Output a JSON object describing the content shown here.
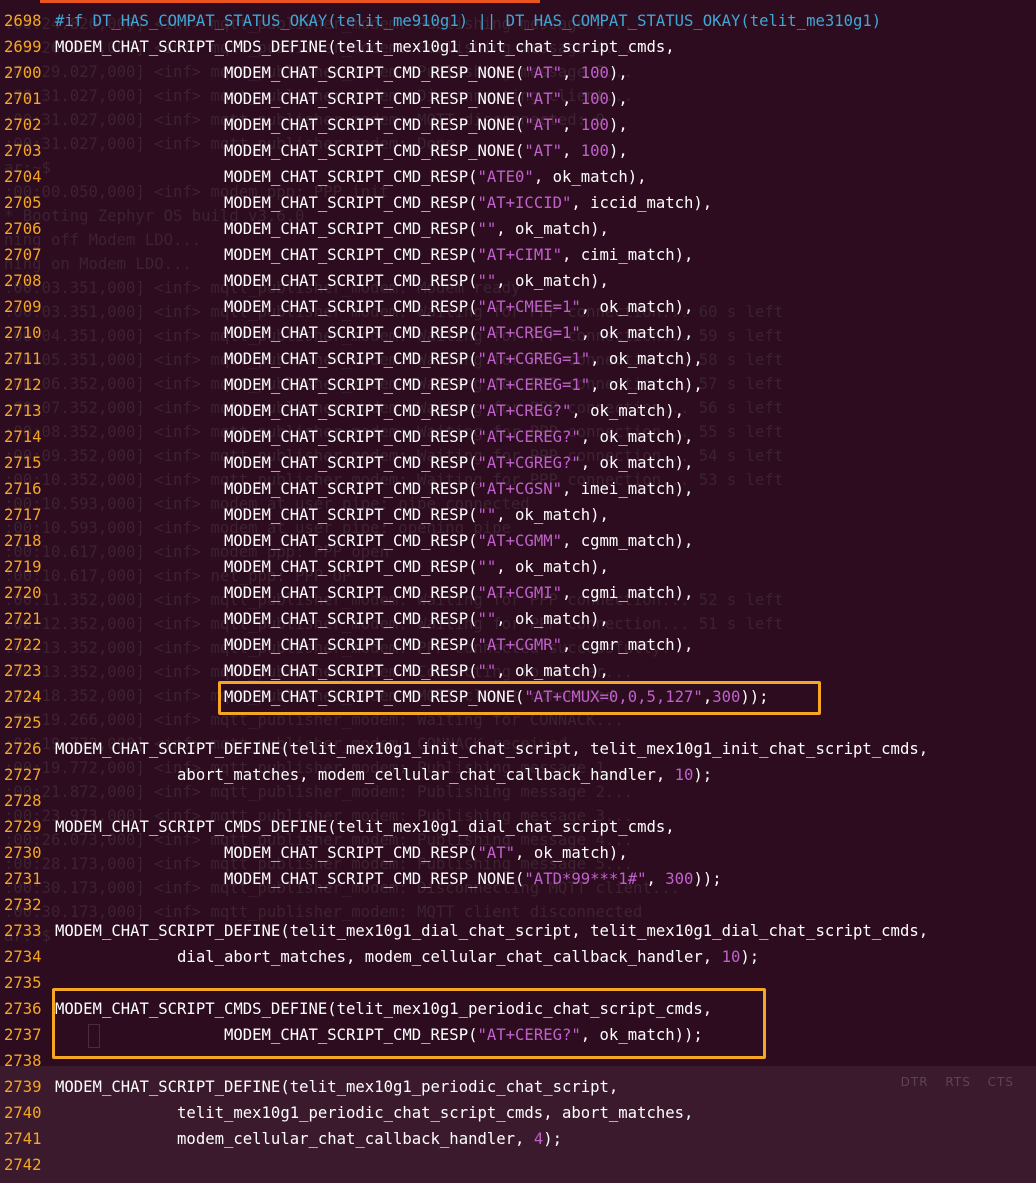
{
  "editor": {
    "background_color": "#2c0c1e",
    "line_number_color": "#f5a623",
    "highlight_color": "#f5a623",
    "string_color": "#c061cb",
    "keyword_color": "#3fa7d6"
  },
  "serial_indicators": [
    "DTR",
    "RTS",
    "CTS"
  ],
  "ghost_terminal": [
    ":00:24.826,000] <inf> mqtt_publisher_modem: Publishing message 3...",
    ":00:26.927,000] <inf> mqtt_publisher_modem: Publishing message 4...",
    ":00:29.027,000] <inf> mqtt_publisher_modem: Publishing message 5...",
    ":00:31.027,000] <inf> mqtt_publisher_modem: Disconnecting client...",
    ":00:31.027,000] <inf> mqtt_publisher_modem: MQTT disconnected: 0",
    ":00:31.027,000] <inf> mqtt_publisher_modem: Done",
    "ar:~$",
    ":00:00.050,000] <inf> modem_ppp: PPP init",
    "* Booting Zephyr OS build v3.6.0",
    "ning off Modem LDO...",
    "ning on Modem LDO...",
    ":00:03.351,000] <inf> mqtt_publisher_modem: Modem ready",
    ":00:03.351,000] <inf> mqtt_publisher_modem: Waiting for PPP connection... 60 s left",
    ":00:04.351,000] <inf> mqtt_publisher_modem: Waiting for PPP connection... 59 s left",
    ":00:05.351,000] <inf> mqtt_publisher_modem: Waiting for PPP connection... 58 s left",
    ":00:06.352,000] <inf> mqtt_publisher_modem: Waiting for PPP connection... 57 s left",
    ":00:07.352,000] <inf> mqtt_publisher_modem: Waiting for PPP connection... 56 s left",
    ":00:08.352,000] <inf> mqtt_publisher_modem: Waiting for PPP connection... 55 s left",
    ":00:09.352,000] <inf> mqtt_publisher_modem: Waiting for PPP connection... 54 s left",
    ":00:10.352,000] <inf> mqtt_publisher_modem: Waiting for PPP connection... 53 s left",
    ":00:10.593,000] <inf> modem_at_user_pipe: pipe connected",
    ":00:10.593,000] <inf> modem_at_user_pipe: opening pipe",
    ":00:10.617,000] <inf> modem_ppp: PPP open",
    ":00:10.617,000] <inf> net_ppp: PPP UP",
    ":00:11.352,000] <inf> mqtt_publisher_modem: Waiting for PPP connection... 52 s left",
    ":00:12.352,000] <inf> mqtt_publisher_modem: Waiting for PPP connection... 51 s left",
    ":00:13.352,000] <inf> mqtt_publisher_modem: PPP connected successfully!",
    ":00:13.352,000] <inf> mqtt_publisher_modem: Connecting to broker...",
    ":00:18.352,000] <inf> mqtt_publisher_modem: MQTT client connected",
    ":00:19.266,000] <inf> mqtt_publisher_modem: Waiting for CONNACK...",
    ":00:19.772,000] <inf> mqtt_publisher_modem: CONNACK received",
    ":00:19.772,000] <inf> mqtt_publisher_modem: Publishing message 1...",
    ":00:21.872,000] <inf> mqtt_publisher_modem: Publishing message 2...",
    ":00:23.973,000] <inf> mqtt_publisher_modem: Publishing message 3...",
    ":00:26.073,000] <inf> mqtt_publisher_modem: Publishing message 4...",
    ":00:28.173,000] <inf> mqtt_publisher_modem: Publishing message 5...",
    ":00:30.173,000] <inf> mqtt_publisher_modem: Disconnecting MQTT client...",
    ":00:30.173,000] <inf> mqtt_publisher_modem: MQTT client disconnected",
    "ar:~$"
  ],
  "lines": [
    {
      "num": "2698",
      "tokens": [
        [
          "kw",
          "#if "
        ],
        [
          "pp-text",
          "DT_HAS_COMPAT_STATUS_OKAY(telit_me910g1) || DT_HAS_COMPAT_STATUS_OKAY(telit_me310g1)"
        ]
      ]
    },
    {
      "num": "2699",
      "tokens": [
        [
          "plain",
          "MODEM_CHAT_SCRIPT_CMDS_DEFINE(telit_mex10g1_init_chat_script_cmds,"
        ]
      ]
    },
    {
      "num": "2700",
      "tokens": [
        [
          "plain",
          "                  MODEM_CHAT_SCRIPT_CMD_RESP_NONE("
        ],
        [
          "str",
          "\"AT\""
        ],
        [
          "plain",
          ", "
        ],
        [
          "num",
          "100"
        ],
        [
          "plain",
          "),"
        ]
      ]
    },
    {
      "num": "2701",
      "tokens": [
        [
          "plain",
          "                  MODEM_CHAT_SCRIPT_CMD_RESP_NONE("
        ],
        [
          "str",
          "\"AT\""
        ],
        [
          "plain",
          ", "
        ],
        [
          "num",
          "100"
        ],
        [
          "plain",
          "),"
        ]
      ]
    },
    {
      "num": "2702",
      "tokens": [
        [
          "plain",
          "                  MODEM_CHAT_SCRIPT_CMD_RESP_NONE("
        ],
        [
          "str",
          "\"AT\""
        ],
        [
          "plain",
          ", "
        ],
        [
          "num",
          "100"
        ],
        [
          "plain",
          "),"
        ]
      ]
    },
    {
      "num": "2703",
      "tokens": [
        [
          "plain",
          "                  MODEM_CHAT_SCRIPT_CMD_RESP_NONE("
        ],
        [
          "str",
          "\"AT\""
        ],
        [
          "plain",
          ", "
        ],
        [
          "num",
          "100"
        ],
        [
          "plain",
          "),"
        ]
      ]
    },
    {
      "num": "2704",
      "tokens": [
        [
          "plain",
          "                  MODEM_CHAT_SCRIPT_CMD_RESP("
        ],
        [
          "str",
          "\"ATE0\""
        ],
        [
          "plain",
          ", ok_match),"
        ]
      ]
    },
    {
      "num": "2705",
      "tokens": [
        [
          "plain",
          "                  MODEM_CHAT_SCRIPT_CMD_RESP("
        ],
        [
          "str",
          "\"AT+ICCID\""
        ],
        [
          "plain",
          ", iccid_match),"
        ]
      ]
    },
    {
      "num": "2706",
      "tokens": [
        [
          "plain",
          "                  MODEM_CHAT_SCRIPT_CMD_RESP("
        ],
        [
          "str",
          "\"\""
        ],
        [
          "plain",
          ", ok_match),"
        ]
      ]
    },
    {
      "num": "2707",
      "tokens": [
        [
          "plain",
          "                  MODEM_CHAT_SCRIPT_CMD_RESP("
        ],
        [
          "str",
          "\"AT+CIMI\""
        ],
        [
          "plain",
          ", cimi_match),"
        ]
      ]
    },
    {
      "num": "2708",
      "tokens": [
        [
          "plain",
          "                  MODEM_CHAT_SCRIPT_CMD_RESP("
        ],
        [
          "str",
          "\"\""
        ],
        [
          "plain",
          ", ok_match),"
        ]
      ]
    },
    {
      "num": "2709",
      "tokens": [
        [
          "plain",
          "                  MODEM_CHAT_SCRIPT_CMD_RESP("
        ],
        [
          "str",
          "\"AT+CMEE=1\""
        ],
        [
          "plain",
          ", ok_match),"
        ]
      ]
    },
    {
      "num": "2710",
      "tokens": [
        [
          "plain",
          "                  MODEM_CHAT_SCRIPT_CMD_RESP("
        ],
        [
          "str",
          "\"AT+CREG=1\""
        ],
        [
          "plain",
          ", ok_match),"
        ]
      ]
    },
    {
      "num": "2711",
      "tokens": [
        [
          "plain",
          "                  MODEM_CHAT_SCRIPT_CMD_RESP("
        ],
        [
          "str",
          "\"AT+CGREG=1\""
        ],
        [
          "plain",
          ", ok_match),"
        ]
      ]
    },
    {
      "num": "2712",
      "tokens": [
        [
          "plain",
          "                  MODEM_CHAT_SCRIPT_CMD_RESP("
        ],
        [
          "str",
          "\"AT+CEREG=1\""
        ],
        [
          "plain",
          ", ok_match),"
        ]
      ]
    },
    {
      "num": "2713",
      "tokens": [
        [
          "plain",
          "                  MODEM_CHAT_SCRIPT_CMD_RESP("
        ],
        [
          "str",
          "\"AT+CREG?\""
        ],
        [
          "plain",
          ", ok_match),"
        ]
      ]
    },
    {
      "num": "2714",
      "tokens": [
        [
          "plain",
          "                  MODEM_CHAT_SCRIPT_CMD_RESP("
        ],
        [
          "str",
          "\"AT+CEREG?\""
        ],
        [
          "plain",
          ", ok_match),"
        ]
      ]
    },
    {
      "num": "2715",
      "tokens": [
        [
          "plain",
          "                  MODEM_CHAT_SCRIPT_CMD_RESP("
        ],
        [
          "str",
          "\"AT+CGREG?\""
        ],
        [
          "plain",
          ", ok_match),"
        ]
      ]
    },
    {
      "num": "2716",
      "tokens": [
        [
          "plain",
          "                  MODEM_CHAT_SCRIPT_CMD_RESP("
        ],
        [
          "str",
          "\"AT+CGSN\""
        ],
        [
          "plain",
          ", imei_match),"
        ]
      ]
    },
    {
      "num": "2717",
      "tokens": [
        [
          "plain",
          "                  MODEM_CHAT_SCRIPT_CMD_RESP("
        ],
        [
          "str",
          "\"\""
        ],
        [
          "plain",
          ", ok_match),"
        ]
      ]
    },
    {
      "num": "2718",
      "tokens": [
        [
          "plain",
          "                  MODEM_CHAT_SCRIPT_CMD_RESP("
        ],
        [
          "str",
          "\"AT+CGMM\""
        ],
        [
          "plain",
          ", cgmm_match),"
        ]
      ]
    },
    {
      "num": "2719",
      "tokens": [
        [
          "plain",
          "                  MODEM_CHAT_SCRIPT_CMD_RESP("
        ],
        [
          "str",
          "\"\""
        ],
        [
          "plain",
          ", ok_match),"
        ]
      ]
    },
    {
      "num": "2720",
      "tokens": [
        [
          "plain",
          "                  MODEM_CHAT_SCRIPT_CMD_RESP("
        ],
        [
          "str",
          "\"AT+CGMI\""
        ],
        [
          "plain",
          ", cgmi_match),"
        ]
      ]
    },
    {
      "num": "2721",
      "tokens": [
        [
          "plain",
          "                  MODEM_CHAT_SCRIPT_CMD_RESP("
        ],
        [
          "str",
          "\"\""
        ],
        [
          "plain",
          ", ok_match),"
        ]
      ]
    },
    {
      "num": "2722",
      "tokens": [
        [
          "plain",
          "                  MODEM_CHAT_SCRIPT_CMD_RESP("
        ],
        [
          "str",
          "\"AT+CGMR\""
        ],
        [
          "plain",
          ", cgmr_match),"
        ]
      ]
    },
    {
      "num": "2723",
      "tokens": [
        [
          "plain",
          "                  MODEM_CHAT_SCRIPT_CMD_RESP("
        ],
        [
          "str",
          "\"\""
        ],
        [
          "plain",
          ", ok_match),"
        ]
      ]
    },
    {
      "num": "2724",
      "tokens": [
        [
          "plain",
          "                  MODEM_CHAT_SCRIPT_CMD_RESP_NONE("
        ],
        [
          "str",
          "\"AT+CMUX=0,0,5,127\""
        ],
        [
          "plain",
          ","
        ],
        [
          "num",
          "300"
        ],
        [
          "plain",
          "));"
        ]
      ]
    },
    {
      "num": "2725",
      "tokens": []
    },
    {
      "num": "2726",
      "tokens": [
        [
          "plain",
          "MODEM_CHAT_SCRIPT_DEFINE(telit_mex10g1_init_chat_script, telit_mex10g1_init_chat_script_cmds,"
        ]
      ]
    },
    {
      "num": "2727",
      "tokens": [
        [
          "plain",
          "             abort_matches, modem_cellular_chat_callback_handler, "
        ],
        [
          "num",
          "10"
        ],
        [
          "plain",
          ");"
        ]
      ]
    },
    {
      "num": "2728",
      "tokens": []
    },
    {
      "num": "2729",
      "tokens": [
        [
          "plain",
          "MODEM_CHAT_SCRIPT_CMDS_DEFINE(telit_mex10g1_dial_chat_script_cmds,"
        ]
      ]
    },
    {
      "num": "2730",
      "tokens": [
        [
          "plain",
          "                  MODEM_CHAT_SCRIPT_CMD_RESP("
        ],
        [
          "str",
          "\"AT\""
        ],
        [
          "plain",
          ", ok_match),"
        ]
      ]
    },
    {
      "num": "2731",
      "tokens": [
        [
          "plain",
          "                  MODEM_CHAT_SCRIPT_CMD_RESP_NONE("
        ],
        [
          "str",
          "\"ATD*99***1#\""
        ],
        [
          "plain",
          ", "
        ],
        [
          "num",
          "300"
        ],
        [
          "plain",
          "));"
        ]
      ]
    },
    {
      "num": "2732",
      "tokens": []
    },
    {
      "num": "2733",
      "tokens": [
        [
          "plain",
          "MODEM_CHAT_SCRIPT_DEFINE(telit_mex10g1_dial_chat_script, telit_mex10g1_dial_chat_script_cmds,"
        ]
      ]
    },
    {
      "num": "2734",
      "tokens": [
        [
          "plain",
          "             dial_abort_matches, modem_cellular_chat_callback_handler, "
        ],
        [
          "num",
          "10"
        ],
        [
          "plain",
          ");"
        ]
      ]
    },
    {
      "num": "2735",
      "tokens": []
    },
    {
      "num": "2736",
      "tokens": [
        [
          "plain",
          "MODEM_CHAT_SCRIPT_CMDS_DEFINE(telit_mex10g1_periodic_chat_script_cmds,"
        ]
      ]
    },
    {
      "num": "2737",
      "tokens": [
        [
          "plain",
          "                  MODEM_CHAT_SCRIPT_CMD_RESP("
        ],
        [
          "str",
          "\"AT+CEREG?\""
        ],
        [
          "plain",
          ", ok_match));"
        ]
      ]
    },
    {
      "num": "2738",
      "tokens": []
    },
    {
      "num": "2739",
      "tokens": [
        [
          "plain",
          "MODEM_CHAT_SCRIPT_DEFINE(telit_mex10g1_periodic_chat_script,"
        ]
      ]
    },
    {
      "num": "2740",
      "tokens": [
        [
          "plain",
          "             telit_mex10g1_periodic_chat_script_cmds, abort_matches,"
        ]
      ]
    },
    {
      "num": "2741",
      "tokens": [
        [
          "plain",
          "             modem_cellular_chat_callback_handler, "
        ],
        [
          "num",
          "4"
        ],
        [
          "plain",
          ");"
        ]
      ]
    },
    {
      "num": "2742",
      "tokens": []
    }
  ]
}
